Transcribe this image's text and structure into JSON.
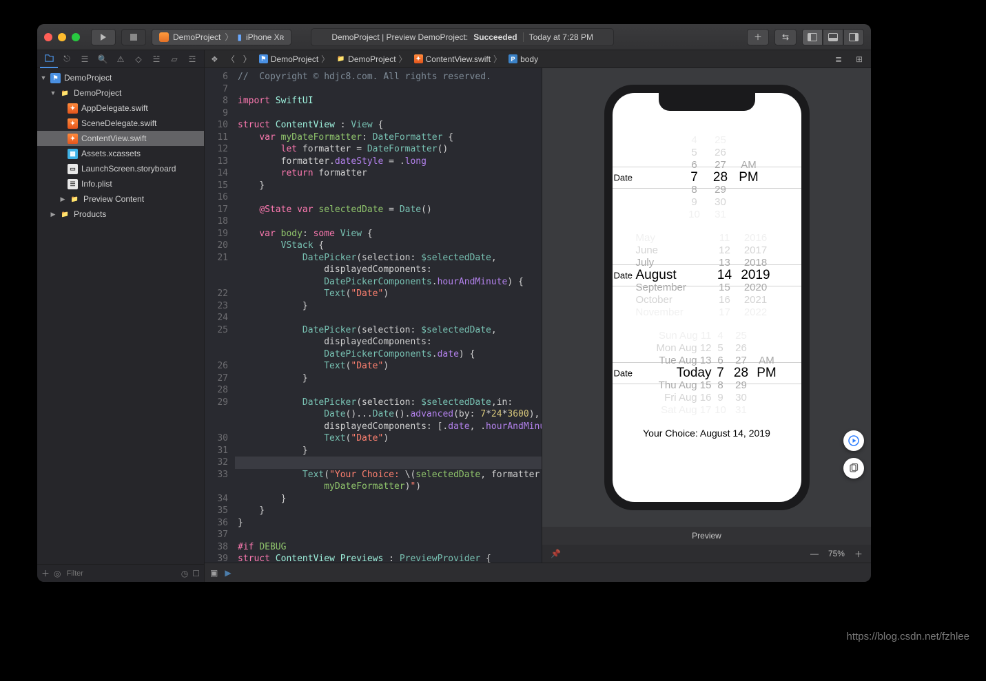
{
  "titlebar": {
    "scheme_project": "DemoProject",
    "scheme_device": "iPhone Xʀ",
    "status_prefix": "DemoProject | Preview DemoProject:",
    "status_result": "Succeeded",
    "status_time": "Today at 7:28 PM"
  },
  "navigator": {
    "root": "DemoProject",
    "group": "DemoProject",
    "files": {
      "app_delegate": "AppDelegate.swift",
      "scene_delegate": "SceneDelegate.swift",
      "content_view": "ContentView.swift",
      "assets": "Assets.xcassets",
      "launch_screen": "LaunchScreen.storyboard",
      "info_plist": "Info.plist",
      "preview_content": "Preview Content",
      "products": "Products"
    },
    "filter_placeholder": "Filter"
  },
  "jumpbar": {
    "crumb1": "DemoProject",
    "crumb2": "DemoProject",
    "crumb3": "ContentView.swift",
    "crumb4": "body"
  },
  "code": {
    "line_start": 6,
    "lines": [
      {
        "n": 6,
        "html": "<span class='cm'>//  Copyright © hdjc8.com. All rights reserved.</span>"
      },
      {
        "n": 7,
        "html": ""
      },
      {
        "n": 8,
        "html": "<span class='kw'>import</span> <span class='typ'>SwiftUI</span>"
      },
      {
        "n": 9,
        "html": ""
      },
      {
        "n": 10,
        "html": "<span class='kw'>struct</span> <span class='typ'>ContentView</span> : <span class='typ2'>View</span> {"
      },
      {
        "n": 11,
        "html": "    <span class='kw'>var</span> <span class='gr'>myDateFormatter</span>: <span class='typ2'>DateFormatter</span> {"
      },
      {
        "n": 12,
        "html": "        <span class='kw'>let</span> formatter = <span class='typ2'>DateFormatter</span>()"
      },
      {
        "n": 13,
        "html": "        formatter.<span class='mem'>dateStyle</span> = .<span class='mem'>long</span>"
      },
      {
        "n": 14,
        "html": "        <span class='kw'>return</span> formatter"
      },
      {
        "n": 15,
        "html": "    }"
      },
      {
        "n": 16,
        "html": ""
      },
      {
        "n": 17,
        "html": "    <span class='deco'>@State</span> <span class='kw'>var</span> <span class='gr'>selectedDate</span> = <span class='typ2'>Date</span>()"
      },
      {
        "n": 18,
        "html": ""
      },
      {
        "n": 19,
        "html": "    <span class='kw'>var</span> <span class='gr'>body</span>: <span class='kw'>some</span> <span class='typ2'>View</span> {"
      },
      {
        "n": 20,
        "html": "        <span class='typ2'>VStack</span> {"
      },
      {
        "n": 21,
        "html": "            <span class='typ2'>DatePicker</span>(selection: <span class='id'>$selectedDate</span>,<br>                displayedComponents:<br>                <span class='typ2'>DatePickerComponents</span>.<span class='mem'>hourAndMinute</span>) {"
      },
      {
        "n": 22,
        "html": "                <span class='typ2'>Text</span>(<span class='str'>\"Date\"</span>)"
      },
      {
        "n": 23,
        "html": "            }"
      },
      {
        "n": 24,
        "html": ""
      },
      {
        "n": 25,
        "html": "            <span class='typ2'>DatePicker</span>(selection: <span class='id'>$selectedDate</span>,<br>                displayedComponents:<br>                <span class='typ2'>DatePickerComponents</span>.<span class='mem'>date</span>) {"
      },
      {
        "n": 26,
        "html": "                <span class='typ2'>Text</span>(<span class='str'>\"Date\"</span>)"
      },
      {
        "n": 27,
        "html": "            }"
      },
      {
        "n": 28,
        "html": ""
      },
      {
        "n": 29,
        "html": "            <span class='typ2'>DatePicker</span>(selection: <span class='id'>$selectedDate</span>,in:<br>                <span class='typ2'>Date</span>()...<span class='typ2'>Date</span>().<span class='mem'>advanced</span>(by: <span class='num'>7</span>*<span class='num'>24</span>*<span class='num'>3600</span>),<br>                displayedComponents: [.<span class='mem'>date</span>, .<span class='mem'>hourAndMinute</span>]) {"
      },
      {
        "n": 30,
        "html": "                <span class='typ2'>Text</span>(<span class='str'>\"Date\"</span>)"
      },
      {
        "n": 31,
        "html": "            }"
      },
      {
        "n": 32,
        "html": "",
        "hl": true
      },
      {
        "n": 33,
        "html": "            <span class='typ2'>Text</span>(<span class='str'>\"Your Choice: </span>\\(<span class='gr'>selectedDate</span>, formatter:<br>                <span class='gr'>myDateFormatter</span>)<span class='str'>\"</span>)"
      },
      {
        "n": 34,
        "html": "        }"
      },
      {
        "n": 35,
        "html": "    }"
      },
      {
        "n": 36,
        "html": "}"
      },
      {
        "n": 37,
        "html": ""
      },
      {
        "n": 38,
        "html": "<span class='kw'>#if</span> <span class='gr'>DEBUG</span>"
      },
      {
        "n": 39,
        "html": "<span class='kw'>struct</span> <span class='typ'>ContentView_Previews</span> : <span class='typ2'>PreviewProvider</span> {"
      }
    ]
  },
  "preview": {
    "title": "Preview",
    "zoom": "75%",
    "picker1": {
      "label": "Date",
      "hours": [
        "4",
        "5",
        "6",
        "7",
        "8",
        "9",
        "10"
      ],
      "sel_hour_idx": 3,
      "mins": [
        "25",
        "26",
        "27",
        "28",
        "29",
        "30",
        "31"
      ],
      "sel_min_idx": 3,
      "ampm": [
        "AM",
        "PM"
      ],
      "sel_ampm_idx": 1
    },
    "picker2": {
      "label": "Date",
      "months": [
        "May",
        "June",
        "July",
        "August",
        "September",
        "October",
        "November"
      ],
      "sel_month_idx": 3,
      "days": [
        "11",
        "12",
        "13",
        "14",
        "15",
        "16",
        "17"
      ],
      "sel_day_idx": 3,
      "years": [
        "2016",
        "2017",
        "2018",
        "2019",
        "2020",
        "2021",
        "2022"
      ],
      "sel_year_idx": 3
    },
    "picker3": {
      "label": "Date",
      "dates": [
        "Sun Aug 11",
        "Mon Aug 12",
        "Tue Aug 13",
        "Today",
        "Thu Aug 15",
        "Fri Aug 16",
        "Sat Aug 17"
      ],
      "sel_date_idx": 3,
      "hours": [
        "4",
        "5",
        "6",
        "7",
        "8",
        "9",
        "10"
      ],
      "sel_hour_idx": 3,
      "mins": [
        "25",
        "26",
        "27",
        "28",
        "29",
        "30",
        "31"
      ],
      "sel_min_idx": 3,
      "ampm": [
        "AM",
        "PM"
      ],
      "sel_ampm_idx": 1
    },
    "choice_text": "Your Choice: August 14, 2019"
  },
  "watermark": "https://blog.csdn.net/fzhlee"
}
